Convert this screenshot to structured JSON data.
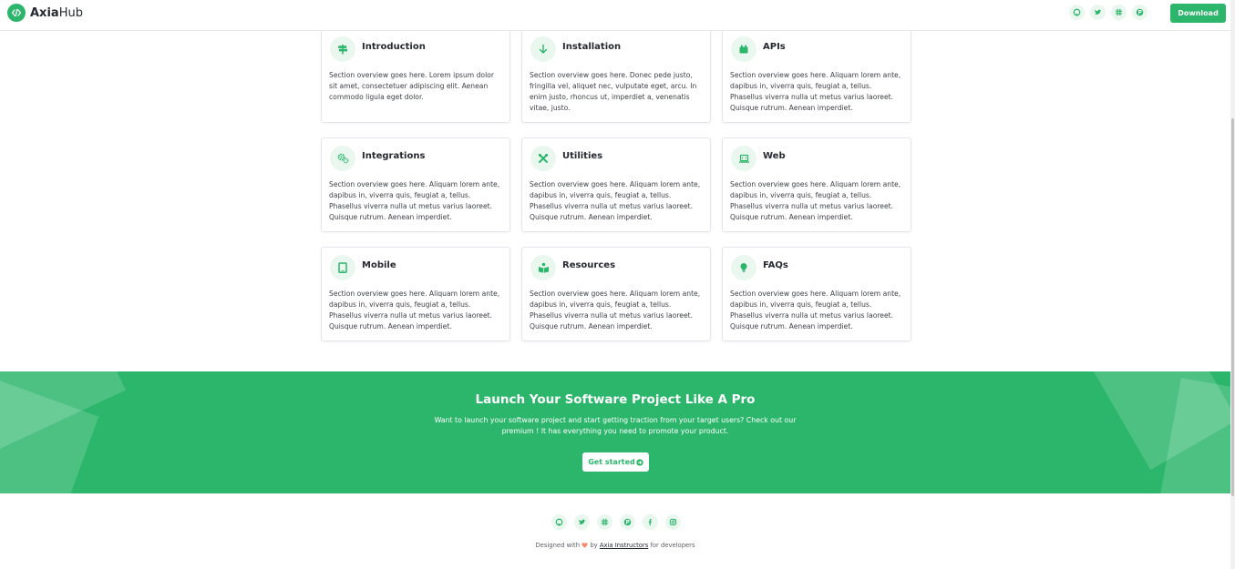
{
  "header": {
    "logo_bold": "Axia",
    "logo_light": "Hub",
    "social_icons": [
      "github-icon",
      "twitter-icon",
      "slack-icon",
      "product-hunt-icon"
    ],
    "download_label": "Download"
  },
  "cards": [
    {
      "title": "Introduction",
      "icon": "signpost-icon",
      "text": "Section overview goes here. Lorem ipsum dolor sit amet, consectetuer adipiscing elit. Aenean commodo ligula eget dolor."
    },
    {
      "title": "Installation",
      "icon": "arrow-down-icon",
      "text": "Section overview goes here. Donec pede justo, fringilla vel, aliquet nec, vulputate eget, arcu. In enim justo, rhoncus ut, imperdiet a, venenatis vitae, justo."
    },
    {
      "title": "APIs",
      "icon": "box-icon",
      "text": "Section overview goes here. Aliquam lorem ante, dapibus in, viverra quis, feugiat a, tellus. Phasellus viverra nulla ut metus varius laoreet. Quisque rutrum. Aenean imperdiet."
    },
    {
      "title": "Integrations",
      "icon": "cogs-icon",
      "text": "Section overview goes here. Aliquam lorem ante, dapibus in, viverra quis, feugiat a, tellus. Phasellus viverra nulla ut metus varius laoreet. Quisque rutrum. Aenean imperdiet."
    },
    {
      "title": "Utilities",
      "icon": "tools-icon",
      "text": "Section overview goes here. Aliquam lorem ante, dapibus in, viverra quis, feugiat a, tellus. Phasellus viverra nulla ut metus varius laoreet. Quisque rutrum. Aenean imperdiet."
    },
    {
      "title": "Web",
      "icon": "laptop-code-icon",
      "text": "Section overview goes here. Aliquam lorem ante, dapibus in, viverra quis, feugiat a, tellus. Phasellus viverra nulla ut metus varius laoreet. Quisque rutrum. Aenean imperdiet."
    },
    {
      "title": "Mobile",
      "icon": "tablet-icon",
      "text": "Section overview goes here. Aliquam lorem ante, dapibus in, viverra quis, feugiat a, tellus. Phasellus viverra nulla ut metus varius laoreet. Quisque rutrum. Aenean imperdiet."
    },
    {
      "title": "Resources",
      "icon": "book-reader-icon",
      "text": "Section overview goes here. Aliquam lorem ante, dapibus in, viverra quis, feugiat a, tellus. Phasellus viverra nulla ut metus varius laoreet. Quisque rutrum. Aenean imperdiet."
    },
    {
      "title": "FAQs",
      "icon": "lightbulb-icon",
      "text": "Section overview goes here. Aliquam lorem ante, dapibus in, viverra quis, feugiat a, tellus. Phasellus viverra nulla ut metus varius laoreet. Quisque rutrum. Aenean imperdiet."
    }
  ],
  "banner": {
    "title": "Launch Your Software Project Like A Pro",
    "text": "Want to launch your software project and start getting traction from your target users? Check out our premium ! It has everything you need to promote your product.",
    "button_label": "Get started"
  },
  "footer": {
    "social_icons": [
      "github-icon",
      "twitter-icon",
      "slack-icon",
      "product-hunt-icon",
      "facebook-icon",
      "instagram-icon"
    ],
    "prefix": "Designed with",
    "by": "by",
    "link_text": "Axia Instructors",
    "suffix": "for developers"
  },
  "colors": {
    "brand": "#2cb66b",
    "brand_light": "#eaf7ef",
    "heart": "#fb866a"
  }
}
